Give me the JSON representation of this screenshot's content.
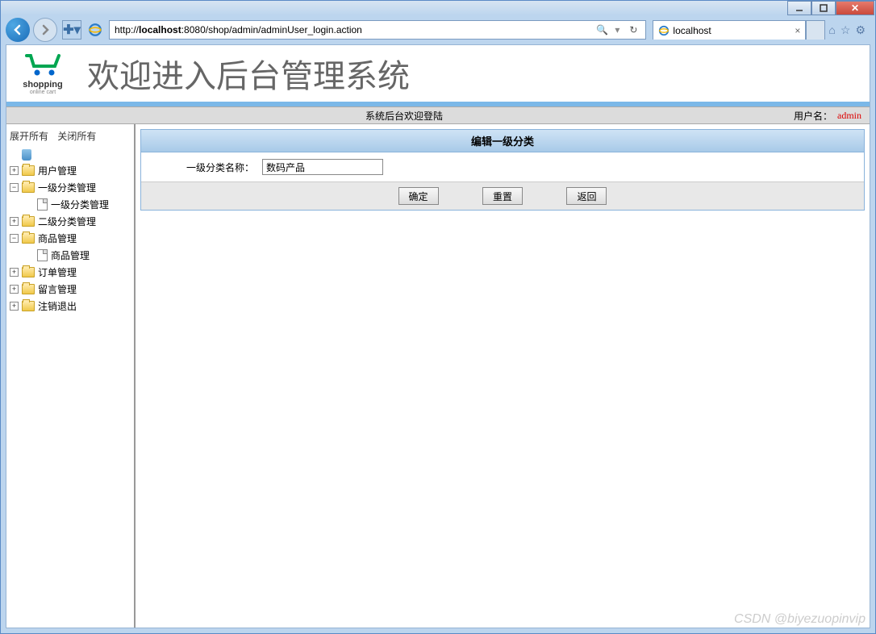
{
  "browser": {
    "url_pre": "http://",
    "url_host": "localhost",
    "url_post": ":8080/shop/admin/adminUser_login.action",
    "tab_title": "localhost",
    "search_icon": "🔍",
    "refresh_icon": "↻"
  },
  "header": {
    "logo_line1": "shopping",
    "logo_line2": "online cart",
    "title": "欢迎进入后台管理系统"
  },
  "infobar": {
    "welcome": "系统后台欢迎登陆",
    "user_label": "用户名：",
    "username": "admin"
  },
  "sidebar": {
    "expand_all": "展开所有",
    "collapse_all": "关闭所有",
    "items": [
      {
        "label": "用户管理",
        "type": "folder",
        "toggle": "+"
      },
      {
        "label": "一级分类管理",
        "type": "folder",
        "toggle": "−"
      },
      {
        "label": "一级分类管理",
        "type": "page",
        "child": true
      },
      {
        "label": "二级分类管理",
        "type": "folder",
        "toggle": "+"
      },
      {
        "label": "商品管理",
        "type": "folder",
        "toggle": "−"
      },
      {
        "label": "商品管理",
        "type": "page",
        "child": true
      },
      {
        "label": "订单管理",
        "type": "folder",
        "toggle": "+"
      },
      {
        "label": "留言管理",
        "type": "folder",
        "toggle": "+"
      },
      {
        "label": "注销退出",
        "type": "folder",
        "toggle": "+"
      }
    ]
  },
  "panel": {
    "title": "编辑一级分类",
    "field_label": "一级分类名称：",
    "field_value": "数码产品",
    "btn_ok": "确定",
    "btn_reset": "重置",
    "btn_back": "返回"
  },
  "watermark": "CSDN @biyezuopinvip"
}
